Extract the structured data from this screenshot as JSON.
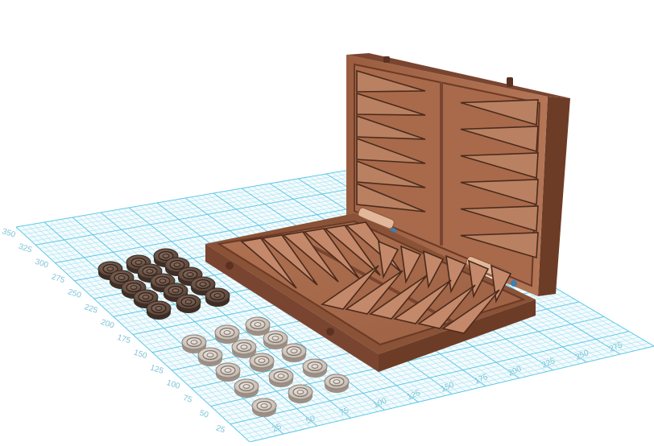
{
  "viewport": {
    "background": "#ffffff",
    "grid_color": "#5bc8e6",
    "grid_fine_color": "#a9e2f1",
    "ruler_color": "#7cc3d6"
  },
  "ruler_left": {
    "labels": [
      "350",
      "325",
      "300",
      "275",
      "250",
      "225",
      "200",
      "175",
      "150",
      "125",
      "100",
      "75",
      "50",
      "25"
    ]
  },
  "ruler_bottom": {
    "labels": [
      "25",
      "50",
      "75",
      "100",
      "125",
      "150",
      "175",
      "200",
      "225",
      "250",
      "275"
    ]
  },
  "model": {
    "name": "backgammon-board",
    "wood_color": "#8a5236",
    "wood_light": "#a8694a",
    "wood_dark": "#5b3221",
    "triangle_color": "#4a2a1c",
    "dark_checker_color": "#6e5547",
    "light_checker_color": "#d9cfc6",
    "hinge_color": "#e2b79a"
  }
}
